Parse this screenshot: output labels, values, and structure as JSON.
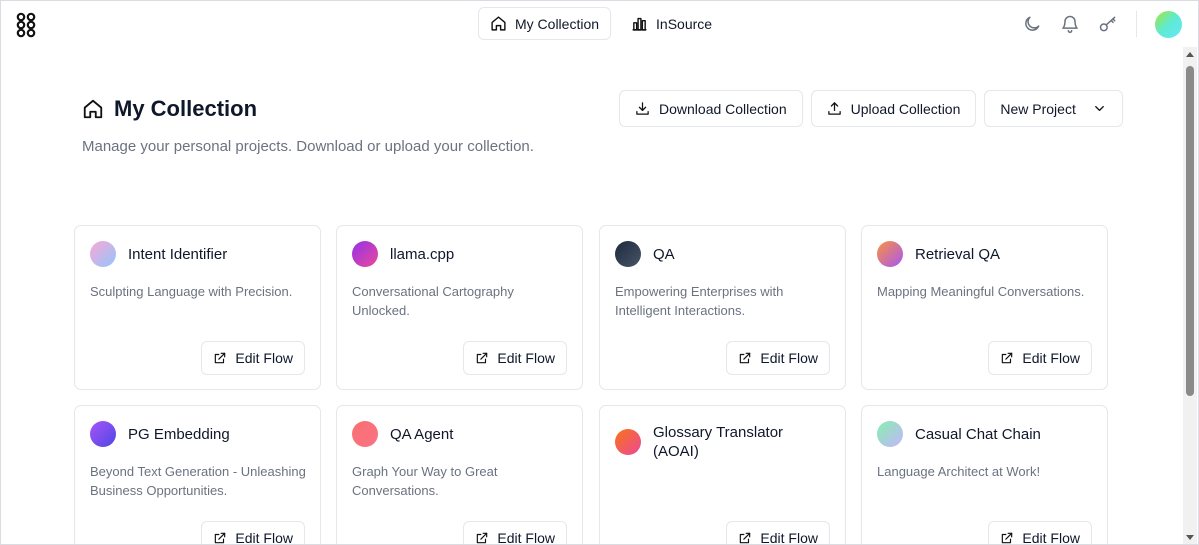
{
  "header": {
    "tabs": [
      {
        "label": "My Collection",
        "icon": "home-icon",
        "active": true
      },
      {
        "label": "InSource",
        "icon": "bar-chart-icon",
        "active": false
      }
    ],
    "icons": [
      "moon-icon",
      "bell-icon",
      "key-icon"
    ]
  },
  "page": {
    "title": "My Collection",
    "description": "Manage your personal projects. Download or upload your collection.",
    "download_label": "Download Collection",
    "upload_label": "Upload Collection",
    "new_project_label": "New Project"
  },
  "edit_label": "Edit Flow",
  "cards": [
    {
      "title": "Intent Identifier",
      "desc": "Sculpting Language with Precision.",
      "gradient": [
        "#f9a8d4",
        "#93c5fd"
      ]
    },
    {
      "title": "llama.cpp",
      "desc": "Conversational Cartography Unlocked.",
      "gradient": [
        "#9333ea",
        "#ec4899"
      ]
    },
    {
      "title": "QA",
      "desc": "Empowering Enterprises with Intelligent Interactions.",
      "gradient": [
        "#1e293b",
        "#475569"
      ]
    },
    {
      "title": "Retrieval QA",
      "desc": "Mapping Meaningful Conversations.",
      "gradient": [
        "#fb923c",
        "#a855f7"
      ]
    },
    {
      "title": "PG Embedding",
      "desc": "Beyond Text Generation - Unleashing Business Opportunities.",
      "gradient": [
        "#a855f7",
        "#4f46e5"
      ]
    },
    {
      "title": "QA Agent",
      "desc": "Graph Your Way to Great Conversations.",
      "gradient": [
        "#f87171",
        "#fb7185"
      ]
    },
    {
      "title": "Glossary Translator (AOAI)",
      "desc": "",
      "gradient": [
        "#f97316",
        "#ec4899"
      ]
    },
    {
      "title": "Casual Chat Chain",
      "desc": "Language Architect at Work!",
      "gradient": [
        "#86efac",
        "#c4b5fd"
      ]
    }
  ]
}
